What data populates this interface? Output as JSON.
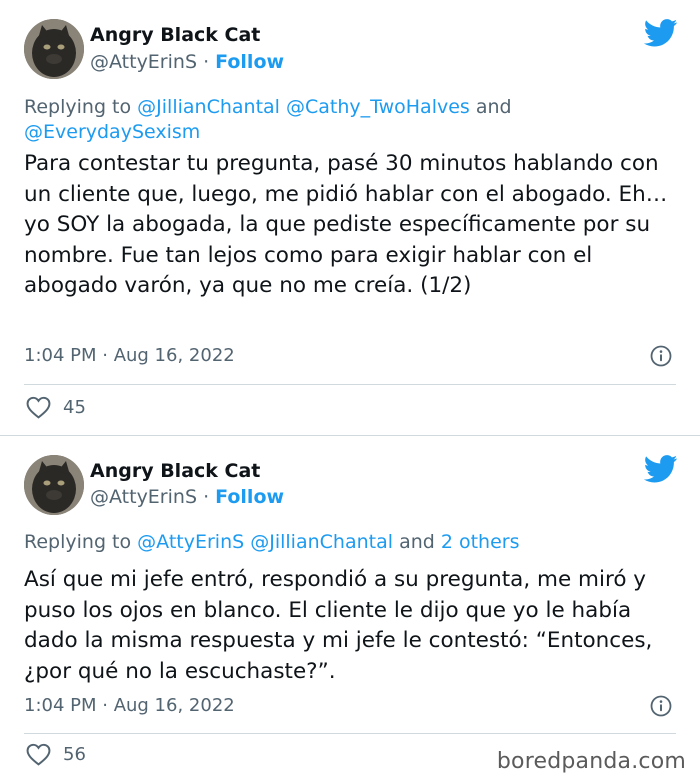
{
  "tweets": [
    {
      "author_name": "Angry Black Cat",
      "handle": "@AttyErinS",
      "separator": "·",
      "follow_label": "Follow",
      "replying_prefix": "Replying to",
      "replying_mentions": [
        "@JillianChantal",
        "@Cathy_TwoHalves"
      ],
      "replying_joiner": "and",
      "replying_last": "@EverydaySexism",
      "text": "Para contestar tu pregunta, pasé 30 minutos hablando con un cliente que, luego, me pidió hablar con el abogado. Eh… yo SOY la abogada, la que pediste específicamente por su nombre. Fue tan lejos como para exigir hablar con el abogado varón, ya que no me creía. (1/2)",
      "timestamp": "1:04 PM · Aug 16, 2022",
      "likes": "45"
    },
    {
      "author_name": "Angry Black Cat",
      "handle": "@AttyErinS",
      "separator": "·",
      "follow_label": "Follow",
      "replying_prefix": "Replying to",
      "replying_mentions": [
        "@AttyErinS",
        "@JillianChantal"
      ],
      "replying_joiner": "and",
      "replying_last": "2 others",
      "text": "Así que mi jefe entró, respondió a su pregunta, me miró y puso los ojos en blanco. El cliente le dijo que yo le había dado la misma respuesta y mi jefe le contestó: “Entonces, ¿por qué no la escuchaste?”.",
      "timestamp": "1:04 PM · Aug 16, 2022",
      "likes": "56"
    }
  ],
  "icons": {
    "brand": "twitter-bird-icon",
    "info": "info-icon",
    "like": "heart-icon"
  },
  "colors": {
    "accent": "#1d9bf0",
    "text": "#0f1419",
    "muted": "#536471",
    "divider": "#cfd9de"
  },
  "watermark": "boredpanda.com"
}
